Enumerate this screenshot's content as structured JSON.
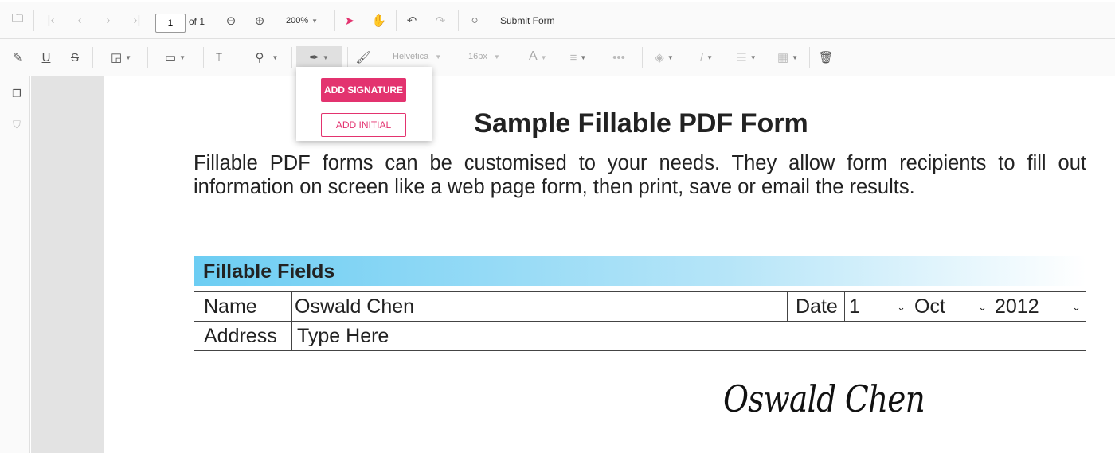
{
  "toolbar": {
    "page_number": "1",
    "page_count": "of 1",
    "zoom": "200%",
    "submit_label": "Submit Form",
    "font_family": "Helvetica",
    "font_size": "16px",
    "font_color_glyph": "A"
  },
  "signature_menu": {
    "add_signature": "ADD SIGNATURE",
    "add_initial": "ADD INITIAL"
  },
  "document": {
    "title": "Sample Fillable PDF Form",
    "paragraph": "Fillable PDF forms can be customised to your needs. They allow form recipients to fill out information on screen like a web page form, then print, save or email the results.",
    "section": "Fillable Fields",
    "name_label": "Name",
    "name_value": "Oswald Chen",
    "date_label": "Date",
    "day": "1",
    "month": "Oct",
    "year": "2012",
    "address_label": "Address",
    "address_value": "Type Here",
    "signature": "Oswald Chen"
  },
  "colors": {
    "accent": "#e3336f",
    "section_bar": "#6ccdf3"
  }
}
